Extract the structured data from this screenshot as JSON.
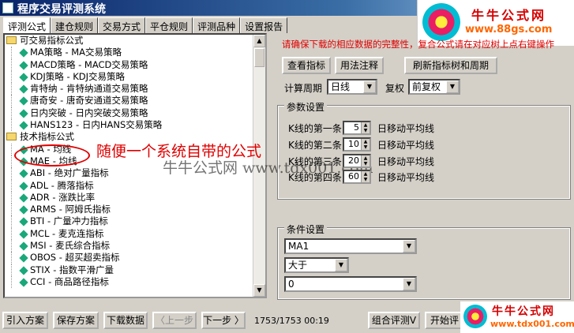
{
  "window": {
    "title": "程序交易评测系统"
  },
  "tabs": [
    "评测公式",
    "建仓规则",
    "交易方式",
    "平仓规则",
    "评测品种",
    "设置报告"
  ],
  "active_tab": 0,
  "tree": {
    "rows": [
      {
        "type": "group",
        "label": "可交易指标公式"
      },
      {
        "type": "item",
        "label": "MA策略 - MA交易策略"
      },
      {
        "type": "item",
        "label": "MACD策略 - MACD交易策略"
      },
      {
        "type": "item",
        "label": "KDJ策略 - KDJ交易策略"
      },
      {
        "type": "item",
        "label": "肯特纳 - 肯特纳通道交易策略"
      },
      {
        "type": "item",
        "label": "唐奇安 - 唐奇安通道交易策略"
      },
      {
        "type": "item",
        "label": "日内突破 - 日内突破交易策略"
      },
      {
        "type": "item",
        "label": "HANS123 - 日内HANS交易策略"
      },
      {
        "type": "group",
        "label": "技术指标公式"
      },
      {
        "type": "item",
        "label": "MA - 均线"
      },
      {
        "type": "item",
        "label": "MAE - 均线"
      },
      {
        "type": "item",
        "label": "ABI - 绝对广量指标"
      },
      {
        "type": "item",
        "label": "ADL - 腾落指标"
      },
      {
        "type": "item",
        "label": "ADR - 涨跌比率"
      },
      {
        "type": "item",
        "label": "ARMS - 阿姆氏指标"
      },
      {
        "type": "item",
        "label": "BTI - 广量冲力指标"
      },
      {
        "type": "item",
        "label": "MCL - 麦克连指标"
      },
      {
        "type": "item",
        "label": "MSI - 麦氏综合指标"
      },
      {
        "type": "item",
        "label": "OBOS - 超买超卖指标"
      },
      {
        "type": "item",
        "label": "STIX - 指数平滑广量"
      },
      {
        "type": "item",
        "label": "CCI - 商品路径指标"
      }
    ]
  },
  "right": {
    "notice": "请确保下载的相应数据的完整性，复合公式请在对应树上点右键操作",
    "buttons": {
      "view": "查看指标",
      "usage": "用法注释",
      "refresh": "刷新指标树和周期"
    },
    "period": {
      "label": "计算周期",
      "value": "日线"
    },
    "adjust": {
      "label": "复权",
      "value": "前复权"
    },
    "params": {
      "title": "参数设置",
      "rows": [
        {
          "label": "K线的第一条",
          "value": "5",
          "unit": "日移动平均线"
        },
        {
          "label": "K线的第二条",
          "value": "10",
          "unit": "日移动平均线"
        },
        {
          "label": "K线的第三条",
          "value": "20",
          "unit": "日移动平均线"
        },
        {
          "label": "K线的第四条",
          "value": "60",
          "unit": "日移动平均线"
        }
      ]
    },
    "conditions": {
      "title": "条件设置",
      "field": "MA1",
      "operator": "大于",
      "value": "0"
    }
  },
  "bottom": {
    "import": "引入方案",
    "save": "保存方案",
    "download": "下载数据",
    "prev": "〈上一步",
    "next": "下一步 〉",
    "status": "1753/1753 00:19",
    "combo": "组合评测V",
    "start": "开始评"
  },
  "annotation": {
    "text": "随便一个系统自带的公式"
  },
  "watermark": {
    "text": "牛牛公式网 www.tdx001.com"
  },
  "logo": {
    "name": "牛牛公式网",
    "url": "www.88gs.com",
    "url2": "www.tdx001.com"
  },
  "colors": {
    "notice": "#e00000",
    "annotation": "#e00000",
    "titlebar": "#0a246a"
  }
}
